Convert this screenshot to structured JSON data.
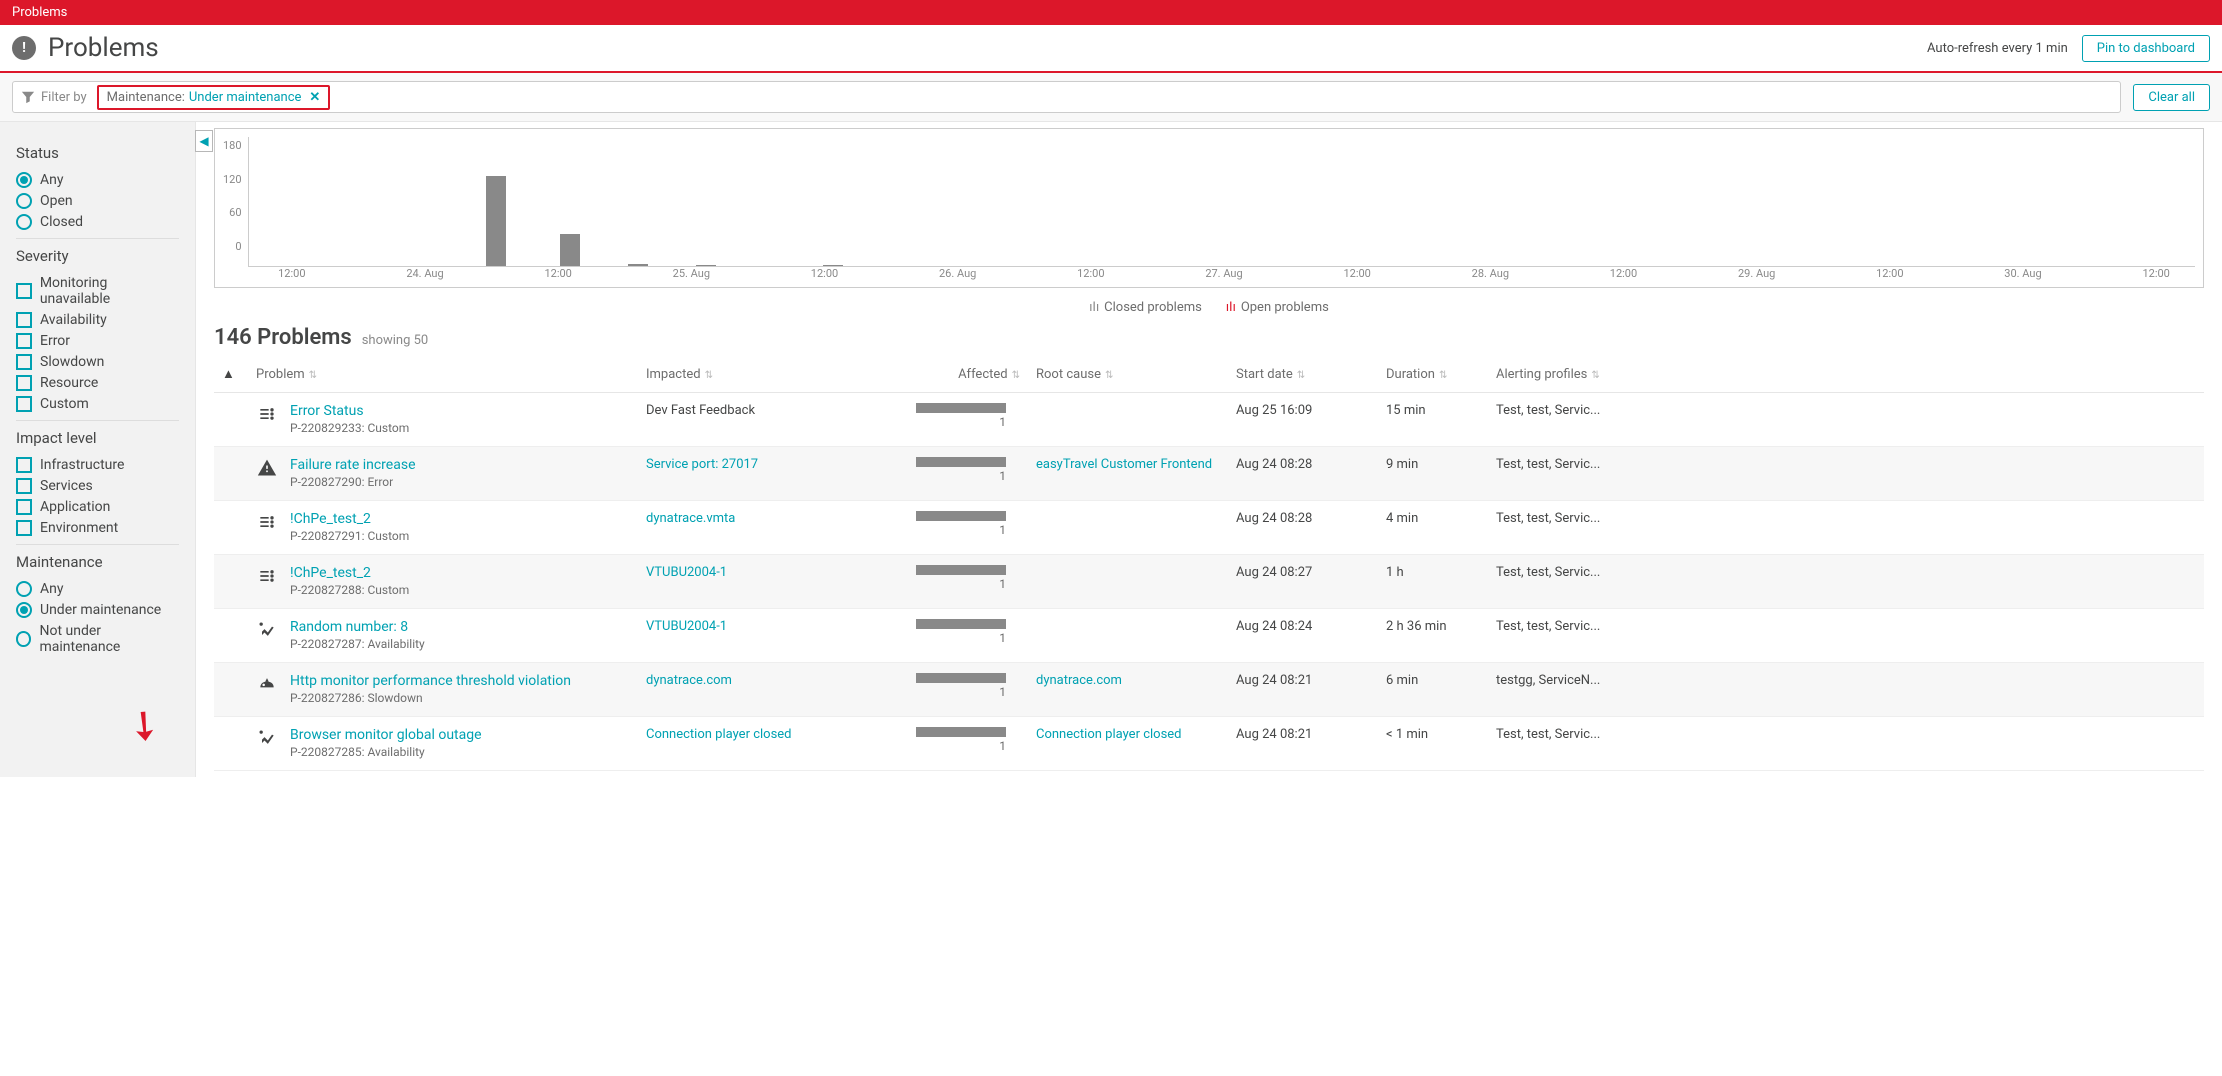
{
  "banner": "Problems",
  "page_title": "Problems",
  "auto_refresh": "Auto-refresh every 1 min",
  "pin_button": "Pin to dashboard",
  "filter": {
    "label": "Filter by",
    "chip_key": "Maintenance:",
    "chip_value": "Under maintenance",
    "clear": "Clear all"
  },
  "sidebar": {
    "status": {
      "title": "Status",
      "items": [
        {
          "label": "Any",
          "selected": true
        },
        {
          "label": "Open",
          "selected": false
        },
        {
          "label": "Closed",
          "selected": false
        }
      ]
    },
    "severity": {
      "title": "Severity",
      "items": [
        "Monitoring unavailable",
        "Availability",
        "Error",
        "Slowdown",
        "Resource",
        "Custom"
      ]
    },
    "impact": {
      "title": "Impact level",
      "items": [
        "Infrastructure",
        "Services",
        "Application",
        "Environment"
      ]
    },
    "maintenance": {
      "title": "Maintenance",
      "items": [
        {
          "label": "Any",
          "selected": false
        },
        {
          "label": "Under maintenance",
          "selected": true
        },
        {
          "label": "Not under maintenance",
          "selected": false
        }
      ]
    }
  },
  "chart": {
    "legend_closed": "Closed problems",
    "legend_open": "Open problems"
  },
  "chart_data": {
    "type": "bar",
    "ylabel": "",
    "ylim": [
      0,
      180
    ],
    "yticks": [
      0,
      60,
      120,
      180
    ],
    "categories": [
      "12:00",
      "24. Aug",
      "12:00",
      "25. Aug",
      "12:00",
      "26. Aug",
      "12:00",
      "27. Aug",
      "12:00",
      "28. Aug",
      "12:00",
      "29. Aug",
      "12:00",
      "30. Aug",
      "12:00"
    ],
    "series": [
      {
        "name": "Closed problems",
        "color": "#898989",
        "bars": [
          {
            "x_percent": 12.2,
            "value": 140
          },
          {
            "x_percent": 16.0,
            "value": 50
          },
          {
            "x_percent": 19.5,
            "value": 3
          },
          {
            "x_percent": 23.0,
            "value": 2
          },
          {
            "x_percent": 29.5,
            "value": 2
          }
        ]
      }
    ]
  },
  "count": {
    "title": "146 Problems",
    "showing": "showing 50"
  },
  "columns": [
    "",
    "Problem",
    "Impacted",
    "Affected",
    "Root cause",
    "Start date",
    "Duration",
    "Alerting profiles"
  ],
  "rows": [
    {
      "icon": "custom",
      "title": "Error Status",
      "sub": "P-220829233: Custom",
      "impacted": "Dev Fast Feedback",
      "impacted_link": false,
      "affected": 1,
      "root": "",
      "start": "Aug 25 16:09",
      "duration": "15 min",
      "profiles": "Test, test, Servic..."
    },
    {
      "icon": "warn",
      "title": "Failure rate increase",
      "sub": "P-220827290: Error",
      "impacted": "Service port: 27017",
      "impacted_link": true,
      "affected": 1,
      "root": "easyTravel Customer Frontend",
      "start": "Aug 24 08:28",
      "duration": "9 min",
      "profiles": "Test, test, Servic..."
    },
    {
      "icon": "custom",
      "title": "!ChPe_test_2",
      "sub": "P-220827291: Custom",
      "impacted": "dynatrace.vmta",
      "impacted_link": true,
      "affected": 1,
      "root": "",
      "start": "Aug 24 08:28",
      "duration": "4 min",
      "profiles": "Test, test, Servic..."
    },
    {
      "icon": "custom",
      "title": "!ChPe_test_2",
      "sub": "P-220827288: Custom",
      "impacted": "VTUBU2004-1",
      "impacted_link": true,
      "affected": 1,
      "root": "",
      "start": "Aug 24 08:27",
      "duration": "1 h",
      "profiles": "Test, test, Servic..."
    },
    {
      "icon": "avail",
      "title": "Random number: 8",
      "sub": "P-220827287: Availability",
      "impacted": "VTUBU2004-1",
      "impacted_link": true,
      "affected": 1,
      "root": "",
      "start": "Aug 24 08:24",
      "duration": "2 h 36 min",
      "profiles": "Test, test, Servic..."
    },
    {
      "icon": "slow",
      "title": "Http monitor performance threshold violation",
      "sub": "P-220827286: Slowdown",
      "impacted": "dynatrace.com",
      "impacted_link": true,
      "affected": 1,
      "root": "dynatrace.com",
      "start": "Aug 24 08:21",
      "duration": "6 min",
      "profiles": "testgg, ServiceN..."
    },
    {
      "icon": "avail",
      "title": "Browser monitor global outage",
      "sub": "P-220827285: Availability",
      "impacted": "Connection player closed",
      "impacted_link": true,
      "affected": 1,
      "root": "Connection player closed",
      "start": "Aug 24 08:21",
      "duration": "< 1 min",
      "profiles": "Test, test, Servic..."
    }
  ]
}
